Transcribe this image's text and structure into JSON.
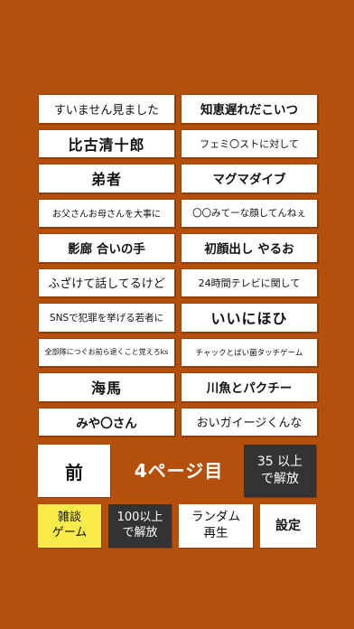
{
  "grid": {
    "items": [
      {
        "label": "すいません見ました"
      },
      {
        "label": "知恵遅れだこいつ"
      },
      {
        "label": "比古清十郎"
      },
      {
        "label": "フェミ〇ストに対して"
      },
      {
        "label": "弟者"
      },
      {
        "label": "マグマダイブ"
      },
      {
        "label": "お父さんお母さんを大事に"
      },
      {
        "label": "〇〇みてーな顔してんねぇ"
      },
      {
        "label": "影廊 合いの手"
      },
      {
        "label": "初顔出し やるお"
      },
      {
        "label": "ふざけて話してるけど"
      },
      {
        "label": "24時間テレビに関して"
      },
      {
        "label": "SNSで犯罪を挙げる若者に"
      },
      {
        "label": "いいにほひ"
      },
      {
        "label": "全部隊につぐお前ら退くこと覚えろks"
      },
      {
        "label": "チャックとばい菌タッチゲーム"
      },
      {
        "label": "海馬"
      },
      {
        "label": "川魚とパクチー"
      },
      {
        "label": "みや〇さん"
      },
      {
        "label": "おいガイージくんな"
      }
    ]
  },
  "nav": {
    "prev_label": "前",
    "page_label": "4ページ目",
    "lock35_line1": "35 以上",
    "lock35_line2": "で解放"
  },
  "bottom": {
    "chat_line1": "雑談",
    "chat_line2": "ゲーム",
    "lock100_line1": "100以上",
    "lock100_line2": "で解放",
    "random_line1": "ランダム",
    "random_line2": "再生",
    "settings_label": "設定"
  },
  "colors": {
    "background": "#b5500c",
    "tile": "#ffffff",
    "locked": "#333333",
    "chat": "#f9ec4a"
  }
}
